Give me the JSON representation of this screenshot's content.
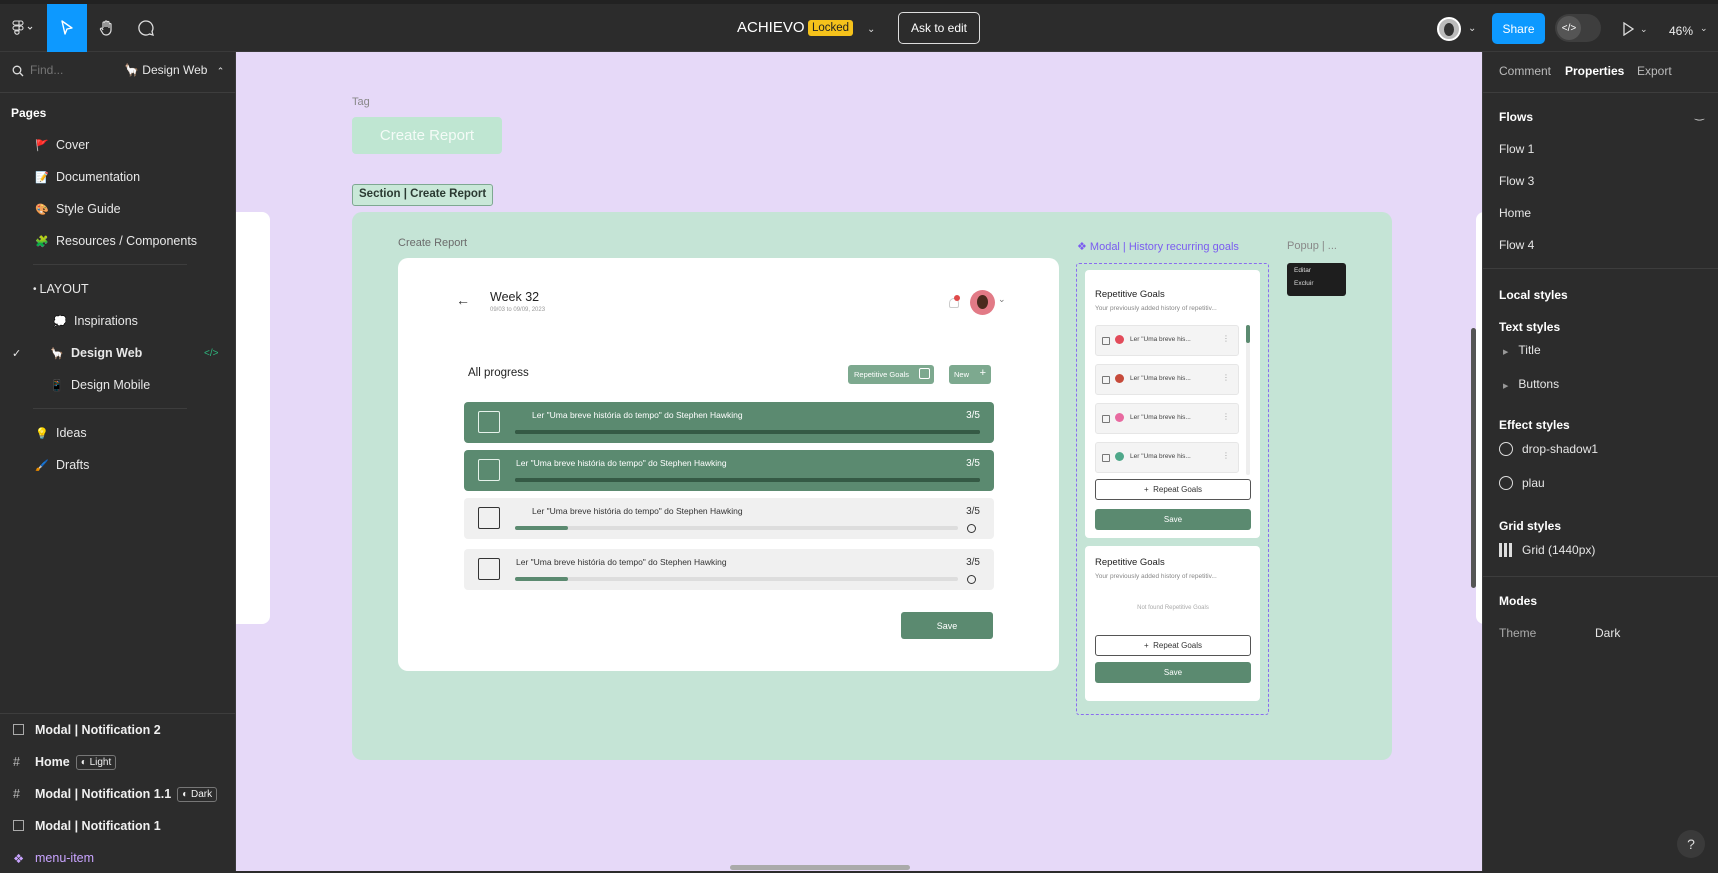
{
  "topbar": {
    "title": "ACHIEVO",
    "badge": "Locked",
    "ask_edit": "Ask to edit",
    "share": "Share",
    "zoom": "46%"
  },
  "sidebar": {
    "search_placeholder": "Find...",
    "page_select": "🦙 Design Web",
    "pages_label": "Pages",
    "pages": [
      {
        "emoji": "🚩",
        "label": "Cover"
      },
      {
        "emoji": "📝",
        "label": "Documentation"
      },
      {
        "emoji": "🎨",
        "label": "Style Guide"
      },
      {
        "emoji": "🧩",
        "label": "Resources / Components"
      },
      {
        "emoji": "•",
        "label": "LAYOUT"
      },
      {
        "emoji": "💭",
        "label": "Inspirations"
      },
      {
        "emoji": "🦙",
        "label": "Design Web"
      },
      {
        "emoji": "📱",
        "label": "Design Mobile"
      },
      {
        "emoji": "💡",
        "label": "Ideas"
      },
      {
        "emoji": "🖌️",
        "label": "Drafts"
      }
    ],
    "layers": [
      {
        "label": "Modal | Notification 2",
        "tag": ""
      },
      {
        "label": "Home",
        "tag": "Light"
      },
      {
        "label": "Modal | Notification 1.1",
        "tag": "Dark"
      },
      {
        "label": "Modal | Notification 1",
        "tag": ""
      },
      {
        "label": "menu-item",
        "tag": ""
      }
    ]
  },
  "canvas": {
    "tag_label": "Tag",
    "create_report_btn": "Create Report",
    "section_label": "Section | Create Report",
    "frame_label": "Create Report",
    "modal_label": "❖ Modal | History recurring goals",
    "popup_label": "Popup | ...",
    "popup_items": [
      "Editar",
      "Excluir"
    ],
    "week_title": "Week 32",
    "week_dates": "09/03 to 09/09, 2023",
    "all_progress": "All progress",
    "repetitive_btn": "Repetitive Goals",
    "new_btn": "New",
    "rows": [
      {
        "text": "Ler \"Uma breve história do tempo\" do Stephen Hawking",
        "count": "3/5",
        "progress": 1.0
      },
      {
        "text": "Ler \"Uma breve história do tempo\" do Stephen Hawking",
        "count": "3/5",
        "progress": 1.0
      },
      {
        "text": "Ler \"Uma breve história do tempo\" do Stephen Hawking",
        "count": "3/5",
        "progress": 0.12
      },
      {
        "text": "Ler \"Uma breve história do tempo\" do Stephen Hawking",
        "count": "3/5",
        "progress": 0.12
      }
    ],
    "save": "Save",
    "modal1": {
      "title": "Repetitive Goals",
      "subtitle": "Your previously added history of repetitiv...",
      "items": [
        "Ler \"Uma breve his...",
        "Ler \"Uma breve his...",
        "Ler \"Uma breve his...",
        "Ler \"Uma breve his..."
      ],
      "repeat": "Repeat Goals",
      "save": "Save"
    },
    "modal2": {
      "title": "Repetitive Goals",
      "subtitle": "Your previously added history of repetitiv...",
      "empty": "Not found Repetitive Goals",
      "repeat": "Repeat Goals",
      "save": "Save"
    }
  },
  "rpanel": {
    "tabs": [
      "Comment",
      "Properties",
      "Export"
    ],
    "flows_label": "Flows",
    "flows": [
      "Flow 1",
      "Flow 3",
      "Home",
      "Flow 4"
    ],
    "local_styles": "Local styles",
    "text_styles": "Text styles",
    "text_items": [
      "Title",
      "Buttons"
    ],
    "effect_styles": "Effect styles",
    "effect_items": [
      "drop-shadow1",
      "plau"
    ],
    "grid_styles": "Grid styles",
    "grid_items": [
      "Grid (1440px)"
    ],
    "modes": "Modes",
    "theme_label": "Theme",
    "theme_value": "Dark"
  },
  "colors": {
    "accent": "#0d99ff",
    "frame_green": "#c5e4d6",
    "row_green": "#5b8a70",
    "canvas_bg": "#e6d9f8"
  }
}
